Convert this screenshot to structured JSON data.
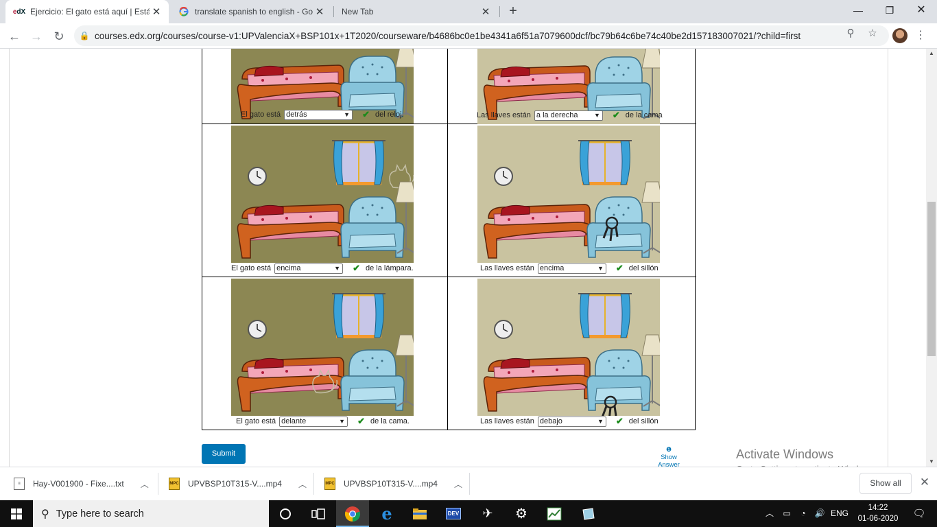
{
  "browser": {
    "tabs": [
      {
        "title": "Ejercicio: El gato está aquí | Está a",
        "favicon": "edx-logo",
        "active": true
      },
      {
        "title": "translate spanish to english - Goo",
        "favicon": "google-icon",
        "active": false
      },
      {
        "title": "New Tab",
        "favicon": "",
        "active": false
      }
    ],
    "url": "courses.edx.org/courses/course-v1:UPValenciaX+BSP101x+1T2020/courseware/b4686bc0e1be4341a6f51a7079600dcf/bc79b64c6be74c40be2d157183007021/?child=first"
  },
  "exercise": {
    "rows": [
      {
        "left": {
          "prefix": "El gato está",
          "selected": "detrás",
          "suffix": "del reloj.",
          "correct": true
        },
        "right": {
          "prefix": "Las llaves están",
          "selected": "a la derecha",
          "suffix": "de la cama",
          "correct": true
        }
      },
      {
        "left": {
          "prefix": "El gato está",
          "selected": "encima",
          "suffix": "de la lámpara.",
          "correct": true
        },
        "right": {
          "prefix": "Las llaves están",
          "selected": "encima",
          "suffix": "del sillón",
          "correct": true
        }
      },
      {
        "left": {
          "prefix": "El gato está",
          "selected": "delante",
          "suffix": "de la cama.",
          "correct": true
        },
        "right": {
          "prefix": "Las llaves están",
          "selected": "debajo",
          "suffix": "del sillón",
          "correct": true
        }
      }
    ],
    "submit_label": "Submit",
    "show_answer_label": "Show Answer"
  },
  "watermark": {
    "line1": "Activate Windows",
    "line2": "Go to Settings to activate Windows."
  },
  "downloads": {
    "items": [
      {
        "name": "Hay-V001900 - Fixe....txt",
        "type": "txt"
      },
      {
        "name": "UPVBSP10T315-V....mp4",
        "type": "mp4"
      },
      {
        "name": "UPVBSP10T315-V....mp4",
        "type": "mp4"
      }
    ],
    "show_all_label": "Show all"
  },
  "taskbar": {
    "search_placeholder": "Type here to search",
    "language": "ENG",
    "time": "14:22",
    "date": "01-06-2020"
  },
  "colors": {
    "wall_dark": "#8c8753",
    "wall_light": "#c9c3a0",
    "check_green": "#1a8a1a",
    "submit_blue": "#0075b4"
  }
}
